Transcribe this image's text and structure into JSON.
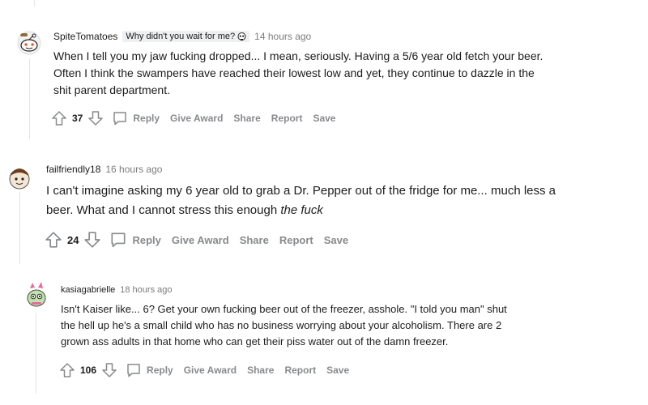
{
  "comments": [
    {
      "username": "SpiteTomatoes",
      "flair": "Why didn't you wait for me?",
      "flair_emoji": "skull-icon",
      "time": "14 hours ago",
      "lines": [
        "When I tell you my jaw fucking dropped... I mean, seriously. Having a 5/6 year old fetch your beer.",
        "Often I think the swampers have reached their lowest low and yet, they continue to dazzle in the",
        "shit parent department."
      ],
      "votes": "37",
      "actions": {
        "reply": "Reply",
        "award": "Give Award",
        "share": "Share",
        "report": "Report",
        "save": "Save"
      }
    },
    {
      "username": "failfriendly18",
      "time": "16 hours ago",
      "lines": [
        "I can't imagine asking my 6 year old to grab a Dr. Pepper out of the fridge for me... much less a",
        "beer. What and I cannot stress this enough "
      ],
      "emphasis": "the fuck",
      "votes": "24",
      "actions": {
        "reply": "Reply",
        "award": "Give Award",
        "share": "Share",
        "report": "Report",
        "save": "Save"
      }
    },
    {
      "username": "kasiagabrielle",
      "time": "18 hours ago",
      "lines": [
        "Isn't Kaiser like... 6? Get your own fucking beer out of the freezer, asshole. \"I told you man\" shut",
        "the hell up he's a small child who has no business worrying about your alcoholism. There are 2",
        "grown ass adults in that home who can get their piss water out of the damn freezer."
      ],
      "votes": "106",
      "actions": {
        "reply": "Reply",
        "award": "Give Award",
        "share": "Share",
        "report": "Report",
        "save": "Save"
      }
    }
  ],
  "colors": {
    "meta_gray": "#7c7c7c",
    "action_gray": "#878a8c",
    "thread_line": "#e5e5e5",
    "flair_bg": "#edeff1"
  }
}
